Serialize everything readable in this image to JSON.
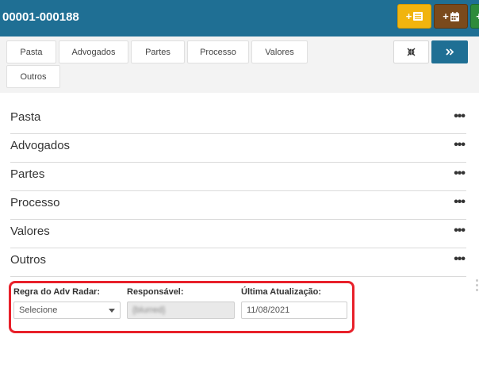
{
  "header": {
    "title": "00001-000188",
    "buttons": [
      {
        "label": "+",
        "icon": "list-icon",
        "color": "#f1b40e"
      },
      {
        "label": "+",
        "icon": "calendar-icon",
        "color": "#7a4a1c"
      },
      {
        "label": "",
        "icon": "add-icon",
        "color": "#2e8b3a"
      }
    ]
  },
  "tabs": [
    "Pasta",
    "Advogados",
    "Partes",
    "Processo",
    "Valores",
    "Outros"
  ],
  "controls": {
    "collapse_icon": "collapse-icon",
    "next_icon": "double-chevron-right-icon"
  },
  "sections": [
    "Pasta",
    "Advogados",
    "Partes",
    "Processo",
    "Valores",
    "Outros"
  ],
  "section_menu": "•••",
  "form": {
    "regra_label": "Regra do Adv Radar:",
    "regra_value": "Selecione",
    "responsavel_label": "Responsável:",
    "responsavel_value": "{blurred}",
    "ultima_label": "Última Atualização:",
    "ultima_value": "11/08/2021"
  }
}
